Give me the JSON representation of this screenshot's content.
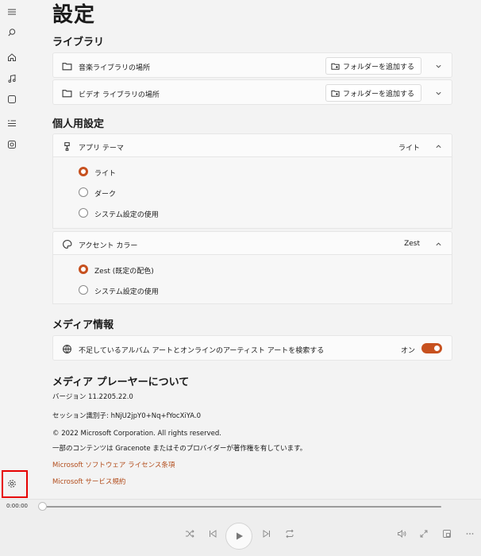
{
  "page": {
    "title": "設定"
  },
  "library": {
    "title": "ライブラリ",
    "rows": [
      {
        "label": "音楽ライブラリの場所",
        "button": "フォルダーを追加する"
      },
      {
        "label": "ビデオ ライブラリの場所",
        "button": "フォルダーを追加する"
      }
    ]
  },
  "personal": {
    "title": "個人用設定",
    "theme": {
      "label": "アプリ テーマ",
      "value": "ライト",
      "options": [
        "ライト",
        "ダーク",
        "システム設定の使用"
      ],
      "selected_index": 0
    },
    "accent": {
      "label": "アクセント カラー",
      "value": "Zest",
      "options": [
        "Zest (既定の配色)",
        "システム設定の使用"
      ],
      "selected_index": 0
    }
  },
  "media_info": {
    "title": "メディア情報",
    "row": {
      "label": "不足しているアルバム アートとオンラインのアーティスト アートを検索する",
      "toggle_label": "オン",
      "toggle_on": true
    }
  },
  "about": {
    "title": "メディア プレーヤーについて",
    "version": "バージョン 11.2205.22.0",
    "session": "セッション識別子: hNjU2jpY0+Nq+fYocXiYA.0",
    "copyright": "© 2022 Microsoft Corporation. All rights reserved.",
    "gracenote": "一部のコンテンツは Gracenote またはそのプロバイダーが著作権を有しています。",
    "license_link": "Microsoft ソフトウェア ライセンス条項",
    "service_link": "Microsoft サービス規約"
  },
  "player": {
    "time": "0:00:00"
  },
  "colors": {
    "accent": "#c7511f",
    "link": "#b24c1b",
    "highlight": "#e60000"
  }
}
